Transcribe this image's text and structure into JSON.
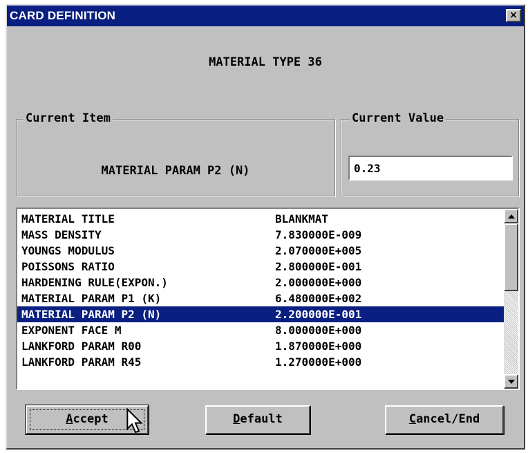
{
  "window": {
    "title": "CARD DEFINITION",
    "close_glyph": "×"
  },
  "heading": "MATERIAL TYPE 36",
  "current_item": {
    "legend": "Current Item",
    "text": "MATERIAL PARAM P2 (N)"
  },
  "current_value": {
    "legend": "Current Value",
    "value": "0.23"
  },
  "list": {
    "selected_index": 6,
    "rows": [
      {
        "name": "MATERIAL TITLE",
        "value": "BLANKMAT"
      },
      {
        "name": "MASS DENSITY",
        "value": "7.830000E-009"
      },
      {
        "name": "YOUNGS MODULUS",
        "value": "2.070000E+005"
      },
      {
        "name": "POISSONS RATIO",
        "value": "2.800000E-001"
      },
      {
        "name": "HARDENING RULE(EXPON.)",
        "value": "2.000000E+000"
      },
      {
        "name": "MATERIAL PARAM P1 (K)",
        "value": "6.480000E+002"
      },
      {
        "name": "MATERIAL PARAM P2 (N)",
        "value": "2.200000E-001"
      },
      {
        "name": "EXPONENT FACE M",
        "value": "8.000000E+000"
      },
      {
        "name": "LANKFORD PARAM R00",
        "value": "1.870000E+000"
      },
      {
        "name": "LANKFORD PARAM R45",
        "value": "1.270000E+000"
      }
    ]
  },
  "buttons": {
    "accept": {
      "mnemonic": "A",
      "rest": "ccept"
    },
    "default": {
      "mnemonic": "D",
      "rest": "efault"
    },
    "cancel": {
      "mnemonic": "C",
      "rest": "ancel/End"
    }
  },
  "colors": {
    "titlebar": "#0a1f82",
    "selection": "#0a1f82",
    "dialog_face": "#c0c0c0"
  },
  "icons": {
    "close": "close-icon",
    "scroll_up": "arrow-up-icon",
    "scroll_down": "arrow-down-icon",
    "pointer": "mouse-pointer-icon"
  }
}
